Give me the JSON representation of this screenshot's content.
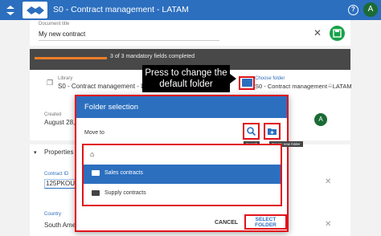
{
  "app": {
    "title": "S0 - Contract management - LATAM",
    "user_initial": "A",
    "help_label": "?"
  },
  "document": {
    "title_label": "Document title",
    "title_value": "My new contract"
  },
  "progress": {
    "text": "3 of 3 mandatory fields completed",
    "fraction": 1.0
  },
  "library": {
    "label": "Library",
    "value": "S0 - Contract management - LATAM",
    "choose_folder_label": "Choose folder",
    "choose_folder_value": "S0 - Contract management - LATAM",
    "created_label": "Created",
    "created_value": "August 28, 2",
    "created_by_initial": "A"
  },
  "annotation": {
    "text": "Press to change the default folder"
  },
  "properties": {
    "title": "Properties",
    "contract_id_label": "Contract ID",
    "contract_id_value": "125PKOUH",
    "country_label": "Country",
    "country_value": "South Amer"
  },
  "dialog": {
    "title": "Folder selection",
    "move_to": "Move to",
    "search_tip": "Search",
    "create_tip": "Create new folder",
    "folders": [
      {
        "name": "Sales contracts",
        "selected": true
      },
      {
        "name": "Supply contracts",
        "selected": false
      }
    ],
    "cancel_label": "CANCEL",
    "select_label": "SELECT FOLDER"
  },
  "colors": {
    "primary": "#2c6fbf",
    "highlight": "#e0131b",
    "accent_progress": "#f07e26",
    "save_green": "#17a34a",
    "avatar_green": "#1b6b35"
  },
  "icons": [
    "menu-icon",
    "handshake-logo-icon",
    "help-icon",
    "library-icon",
    "choose-folder-icon",
    "home-icon",
    "search-icon",
    "create-folder-icon",
    "folder-icon",
    "close-icon",
    "save-icon",
    "chevron-down-icon"
  ]
}
